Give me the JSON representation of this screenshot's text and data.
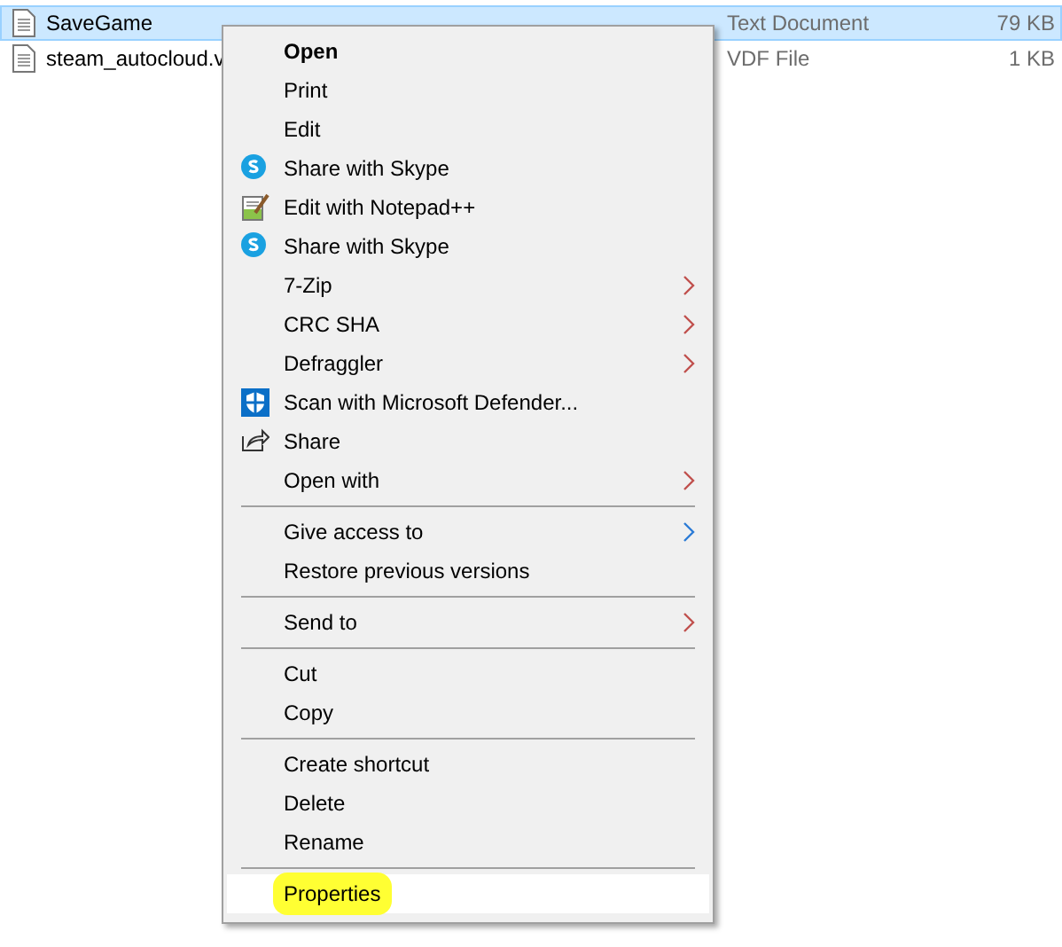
{
  "files": [
    {
      "name": "SaveGame",
      "type": "Text Document",
      "size": "79 KB",
      "selected": true
    },
    {
      "name": "steam_autocloud.v",
      "type": "VDF File",
      "size": "1 KB",
      "selected": false
    }
  ],
  "context_menu": {
    "items": [
      {
        "kind": "item",
        "label": "Open",
        "default": true,
        "submenu": false,
        "hovered": false,
        "marked": false
      },
      {
        "kind": "item",
        "label": "Print",
        "default": false,
        "submenu": false,
        "hovered": false,
        "marked": false
      },
      {
        "kind": "item",
        "label": "Edit",
        "default": false,
        "submenu": false,
        "hovered": false,
        "marked": false
      },
      {
        "kind": "skype",
        "label": "Share with Skype",
        "default": false,
        "submenu": false,
        "hovered": false,
        "marked": false
      },
      {
        "kind": "notepad",
        "label": "Edit with Notepad++",
        "default": false,
        "submenu": false,
        "hovered": false,
        "marked": false
      },
      {
        "kind": "skype",
        "label": "Share with Skype",
        "default": false,
        "submenu": false,
        "hovered": false,
        "marked": false
      },
      {
        "kind": "item",
        "label": "7-Zip",
        "default": false,
        "submenu": true,
        "hovered": false,
        "marked": false
      },
      {
        "kind": "item",
        "label": "CRC SHA",
        "default": false,
        "submenu": true,
        "hovered": false,
        "marked": false
      },
      {
        "kind": "item",
        "label": "Defraggler",
        "default": false,
        "submenu": true,
        "hovered": false,
        "marked": false
      },
      {
        "kind": "shield",
        "label": "Scan with Microsoft Defender...",
        "default": false,
        "submenu": false,
        "hovered": false,
        "marked": false
      },
      {
        "kind": "share",
        "label": "Share",
        "default": false,
        "submenu": false,
        "hovered": false,
        "marked": false
      },
      {
        "kind": "item",
        "label": "Open with",
        "default": false,
        "submenu": true,
        "hovered": false,
        "marked": false
      },
      {
        "kind": "separator"
      },
      {
        "kind": "item",
        "label": "Give access to",
        "default": false,
        "submenu": true,
        "hovered": false,
        "marked": false
      },
      {
        "kind": "item",
        "label": "Restore previous versions",
        "default": false,
        "submenu": false,
        "hovered": false,
        "marked": false
      },
      {
        "kind": "separator"
      },
      {
        "kind": "item",
        "label": "Send to",
        "default": false,
        "submenu": true,
        "hovered": false,
        "marked": false
      },
      {
        "kind": "separator"
      },
      {
        "kind": "item",
        "label": "Cut",
        "default": false,
        "submenu": false,
        "hovered": false,
        "marked": false
      },
      {
        "kind": "item",
        "label": "Copy",
        "default": false,
        "submenu": false,
        "hovered": false,
        "marked": false
      },
      {
        "kind": "separator"
      },
      {
        "kind": "item",
        "label": "Create shortcut",
        "default": false,
        "submenu": false,
        "hovered": false,
        "marked": false
      },
      {
        "kind": "item",
        "label": "Delete",
        "default": false,
        "submenu": false,
        "hovered": false,
        "marked": false
      },
      {
        "kind": "item",
        "label": "Rename",
        "default": false,
        "submenu": false,
        "hovered": false,
        "marked": false
      },
      {
        "kind": "separator"
      },
      {
        "kind": "item",
        "label": "Properties",
        "default": false,
        "submenu": false,
        "hovered": true,
        "marked": true
      }
    ]
  }
}
